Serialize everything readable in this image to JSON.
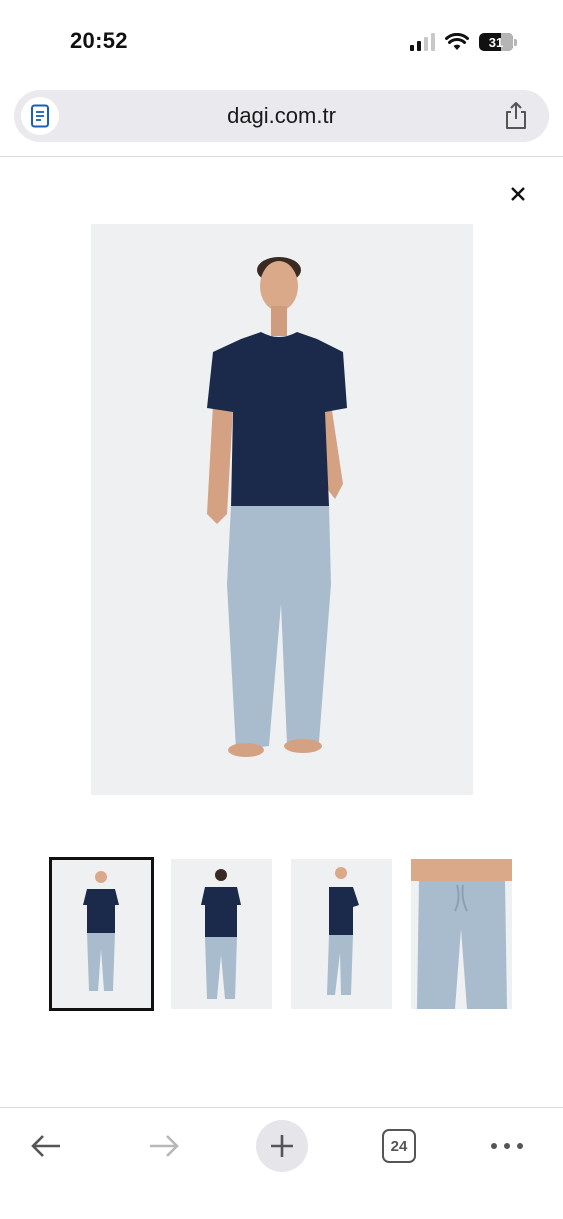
{
  "status_bar": {
    "time": "20:52",
    "battery_level": "31",
    "icons": [
      "signal-icon",
      "wifi-icon",
      "battery-icon"
    ]
  },
  "browser": {
    "url": "dagi.com.tr",
    "reader_icon": "reader-mode-icon",
    "share_icon": "share-icon",
    "tab_count": "24",
    "toolbar_icons": [
      "back-arrow-icon",
      "forward-arrow-icon",
      "plus-icon",
      "tabs-icon",
      "more-icon"
    ]
  },
  "gallery": {
    "close_icon": "close-icon",
    "main_image": {
      "subject": "model-front",
      "shirt_color": "#1b2a4a",
      "pants_color": "#a9bccd"
    },
    "selected_index": 0,
    "thumbnails": [
      {
        "view": "front"
      },
      {
        "view": "back"
      },
      {
        "view": "side"
      },
      {
        "view": "pants-closeup"
      }
    ]
  },
  "colors": {
    "background": "#ffffff",
    "image_bg": "#eef0f1",
    "shirt": "#1b2a4a",
    "pants": "#a9bccd",
    "skin": "#d9a98a"
  }
}
